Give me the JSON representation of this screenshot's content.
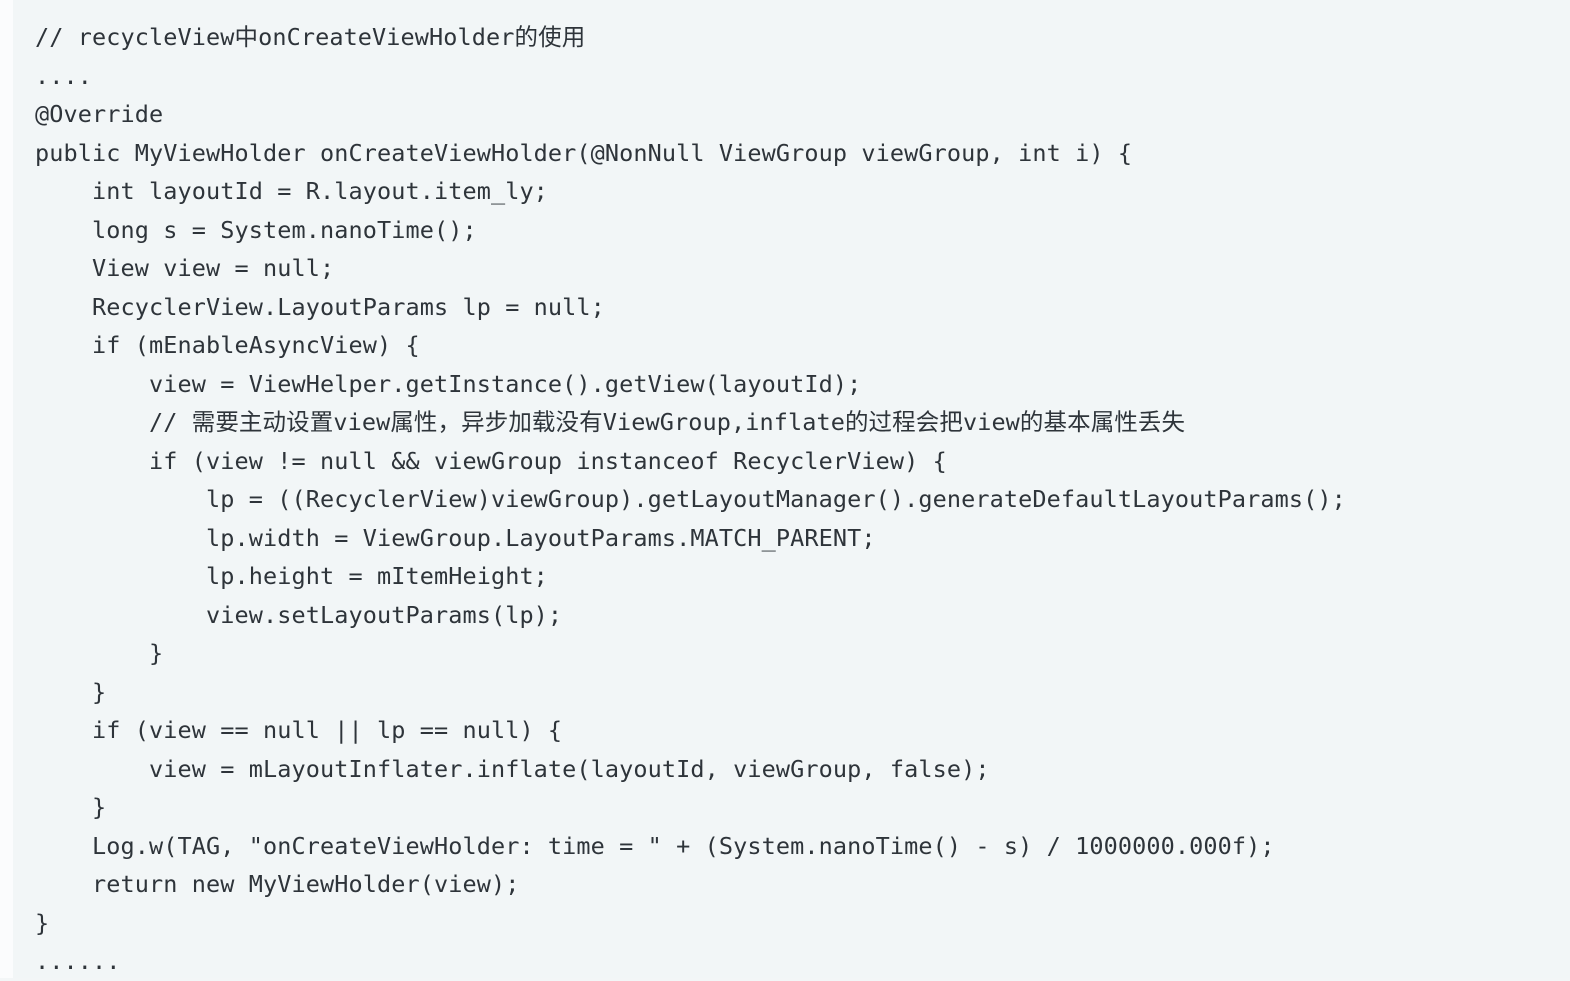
{
  "code": {
    "language": "java",
    "background_color": "#f2f6f7",
    "text_color": "#2e343a",
    "lines": [
      "// recycleView中onCreateViewHolder的使用",
      "....",
      "@Override",
      "public MyViewHolder onCreateViewHolder(@NonNull ViewGroup viewGroup, int i) {",
      "    int layoutId = R.layout.item_ly;",
      "    long s = System.nanoTime();",
      "    View view = null;",
      "    RecyclerView.LayoutParams lp = null;",
      "    if (mEnableAsyncView) {",
      "        view = ViewHelper.getInstance().getView(layoutId);",
      "        // 需要主动设置view属性，异步加载没有ViewGroup,inflate的过程会把view的基本属性丢失",
      "        if (view != null && viewGroup instanceof RecyclerView) {",
      "            lp = ((RecyclerView)viewGroup).getLayoutManager().generateDefaultLayoutParams();",
      "            lp.width = ViewGroup.LayoutParams.MATCH_PARENT;",
      "            lp.height = mItemHeight;",
      "            view.setLayoutParams(lp);",
      "        }",
      "    }",
      "    if (view == null || lp == null) {",
      "        view = mLayoutInflater.inflate(layoutId, viewGroup, false);",
      "    }",
      "    Log.w(TAG, \"onCreateViewHolder: time = \" + (System.nanoTime() - s) / 1000000.000f);",
      "    return new MyViewHolder(view);",
      "}",
      "......"
    ]
  }
}
